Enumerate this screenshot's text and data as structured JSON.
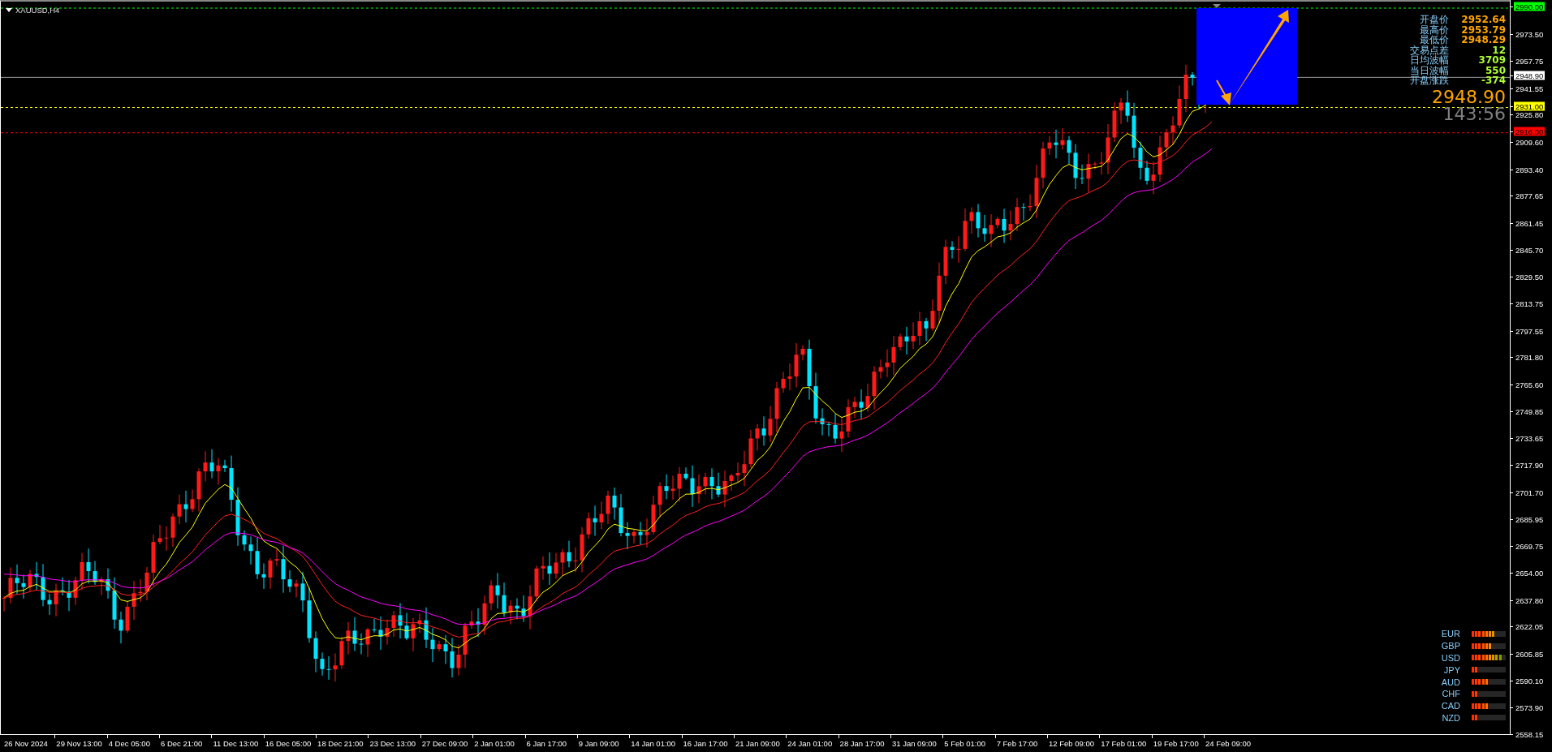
{
  "chart": {
    "symbol": "XAUUSD,H4"
  },
  "info_panel": {
    "rows": [
      {
        "label": "开盘价",
        "value": "2952.64",
        "kind": "price"
      },
      {
        "label": "最高价",
        "value": "2953.79",
        "kind": "price"
      },
      {
        "label": "最低价",
        "value": "2948.29",
        "kind": "price"
      },
      {
        "label": "交易点差",
        "value": "12",
        "kind": "stat"
      },
      {
        "label": "日均波幅",
        "value": "3709",
        "kind": "stat"
      },
      {
        "label": "当日波幅",
        "value": "550",
        "kind": "stat"
      },
      {
        "label": "开盘涨跌",
        "value": "-374",
        "kind": "stat"
      }
    ],
    "current_price": "2948.90",
    "countdown": "143:56"
  },
  "price_axis": {
    "labels": [
      {
        "text": "2990.00",
        "kind": "level",
        "color": "#00ff00"
      },
      {
        "text": "2973.50",
        "kind": "tick"
      },
      {
        "text": "2957.75",
        "kind": "tick"
      },
      {
        "text": "2948.90",
        "kind": "bid",
        "color": "#ffffff"
      },
      {
        "text": "2941.55",
        "kind": "tick"
      },
      {
        "text": "2931.00",
        "kind": "level",
        "color": "#ffff00"
      },
      {
        "text": "2925.80",
        "kind": "tick"
      },
      {
        "text": "2916.00",
        "kind": "level",
        "color": "#ff0000"
      },
      {
        "text": "2909.60",
        "kind": "tick"
      },
      {
        "text": "2893.40",
        "kind": "tick"
      },
      {
        "text": "2877.65",
        "kind": "tick"
      },
      {
        "text": "2861.45",
        "kind": "tick"
      },
      {
        "text": "2845.70",
        "kind": "tick"
      },
      {
        "text": "2829.50",
        "kind": "tick"
      },
      {
        "text": "2813.75",
        "kind": "tick"
      },
      {
        "text": "2797.55",
        "kind": "tick"
      },
      {
        "text": "2781.80",
        "kind": "tick"
      },
      {
        "text": "2765.60",
        "kind": "tick"
      },
      {
        "text": "2749.85",
        "kind": "tick"
      },
      {
        "text": "2733.65",
        "kind": "tick"
      },
      {
        "text": "2717.90",
        "kind": "tick"
      },
      {
        "text": "2701.70",
        "kind": "tick"
      },
      {
        "text": "2685.95",
        "kind": "tick"
      },
      {
        "text": "2669.75",
        "kind": "tick"
      },
      {
        "text": "2654.00",
        "kind": "tick"
      },
      {
        "text": "2637.80",
        "kind": "tick"
      },
      {
        "text": "2622.05",
        "kind": "tick"
      },
      {
        "text": "2605.85",
        "kind": "tick"
      },
      {
        "text": "2590.10",
        "kind": "tick"
      },
      {
        "text": "2573.90",
        "kind": "tick"
      },
      {
        "text": "2558.15",
        "kind": "tick"
      }
    ]
  },
  "time_axis": {
    "labels": [
      "26 Nov 2024",
      "29 Nov 13:00",
      "4 Dec 05:00",
      "6 Dec 21:00",
      "11 Dec 13:00",
      "16 Dec 05:00",
      "18 Dec 21:00",
      "23 Dec 13:00",
      "27 Dec 09:00",
      "2 Jan 01:00",
      "6 Jan 17:00",
      "9 Jan 09:00",
      "14 Jan 01:00",
      "16 Jan 17:00",
      "21 Jan 09:00",
      "24 Jan 01:00",
      "28 Jan 17:00",
      "31 Jan 09:00",
      "5 Feb 01:00",
      "7 Feb 17:00",
      "12 Feb 09:00",
      "17 Feb 01:00",
      "19 Feb 17:00",
      "24 Feb 09:00"
    ]
  },
  "currency_strength": [
    {
      "currency": "EUR",
      "level": 0.7
    },
    {
      "currency": "GBP",
      "level": 0.6
    },
    {
      "currency": "USD",
      "level": 0.9
    },
    {
      "currency": "JPY",
      "level": 0.2
    },
    {
      "currency": "AUD",
      "level": 0.5
    },
    {
      "currency": "CHF",
      "level": 0.2
    },
    {
      "currency": "CAD",
      "level": 0.5
    },
    {
      "currency": "NZD",
      "level": 0.2
    }
  ]
}
